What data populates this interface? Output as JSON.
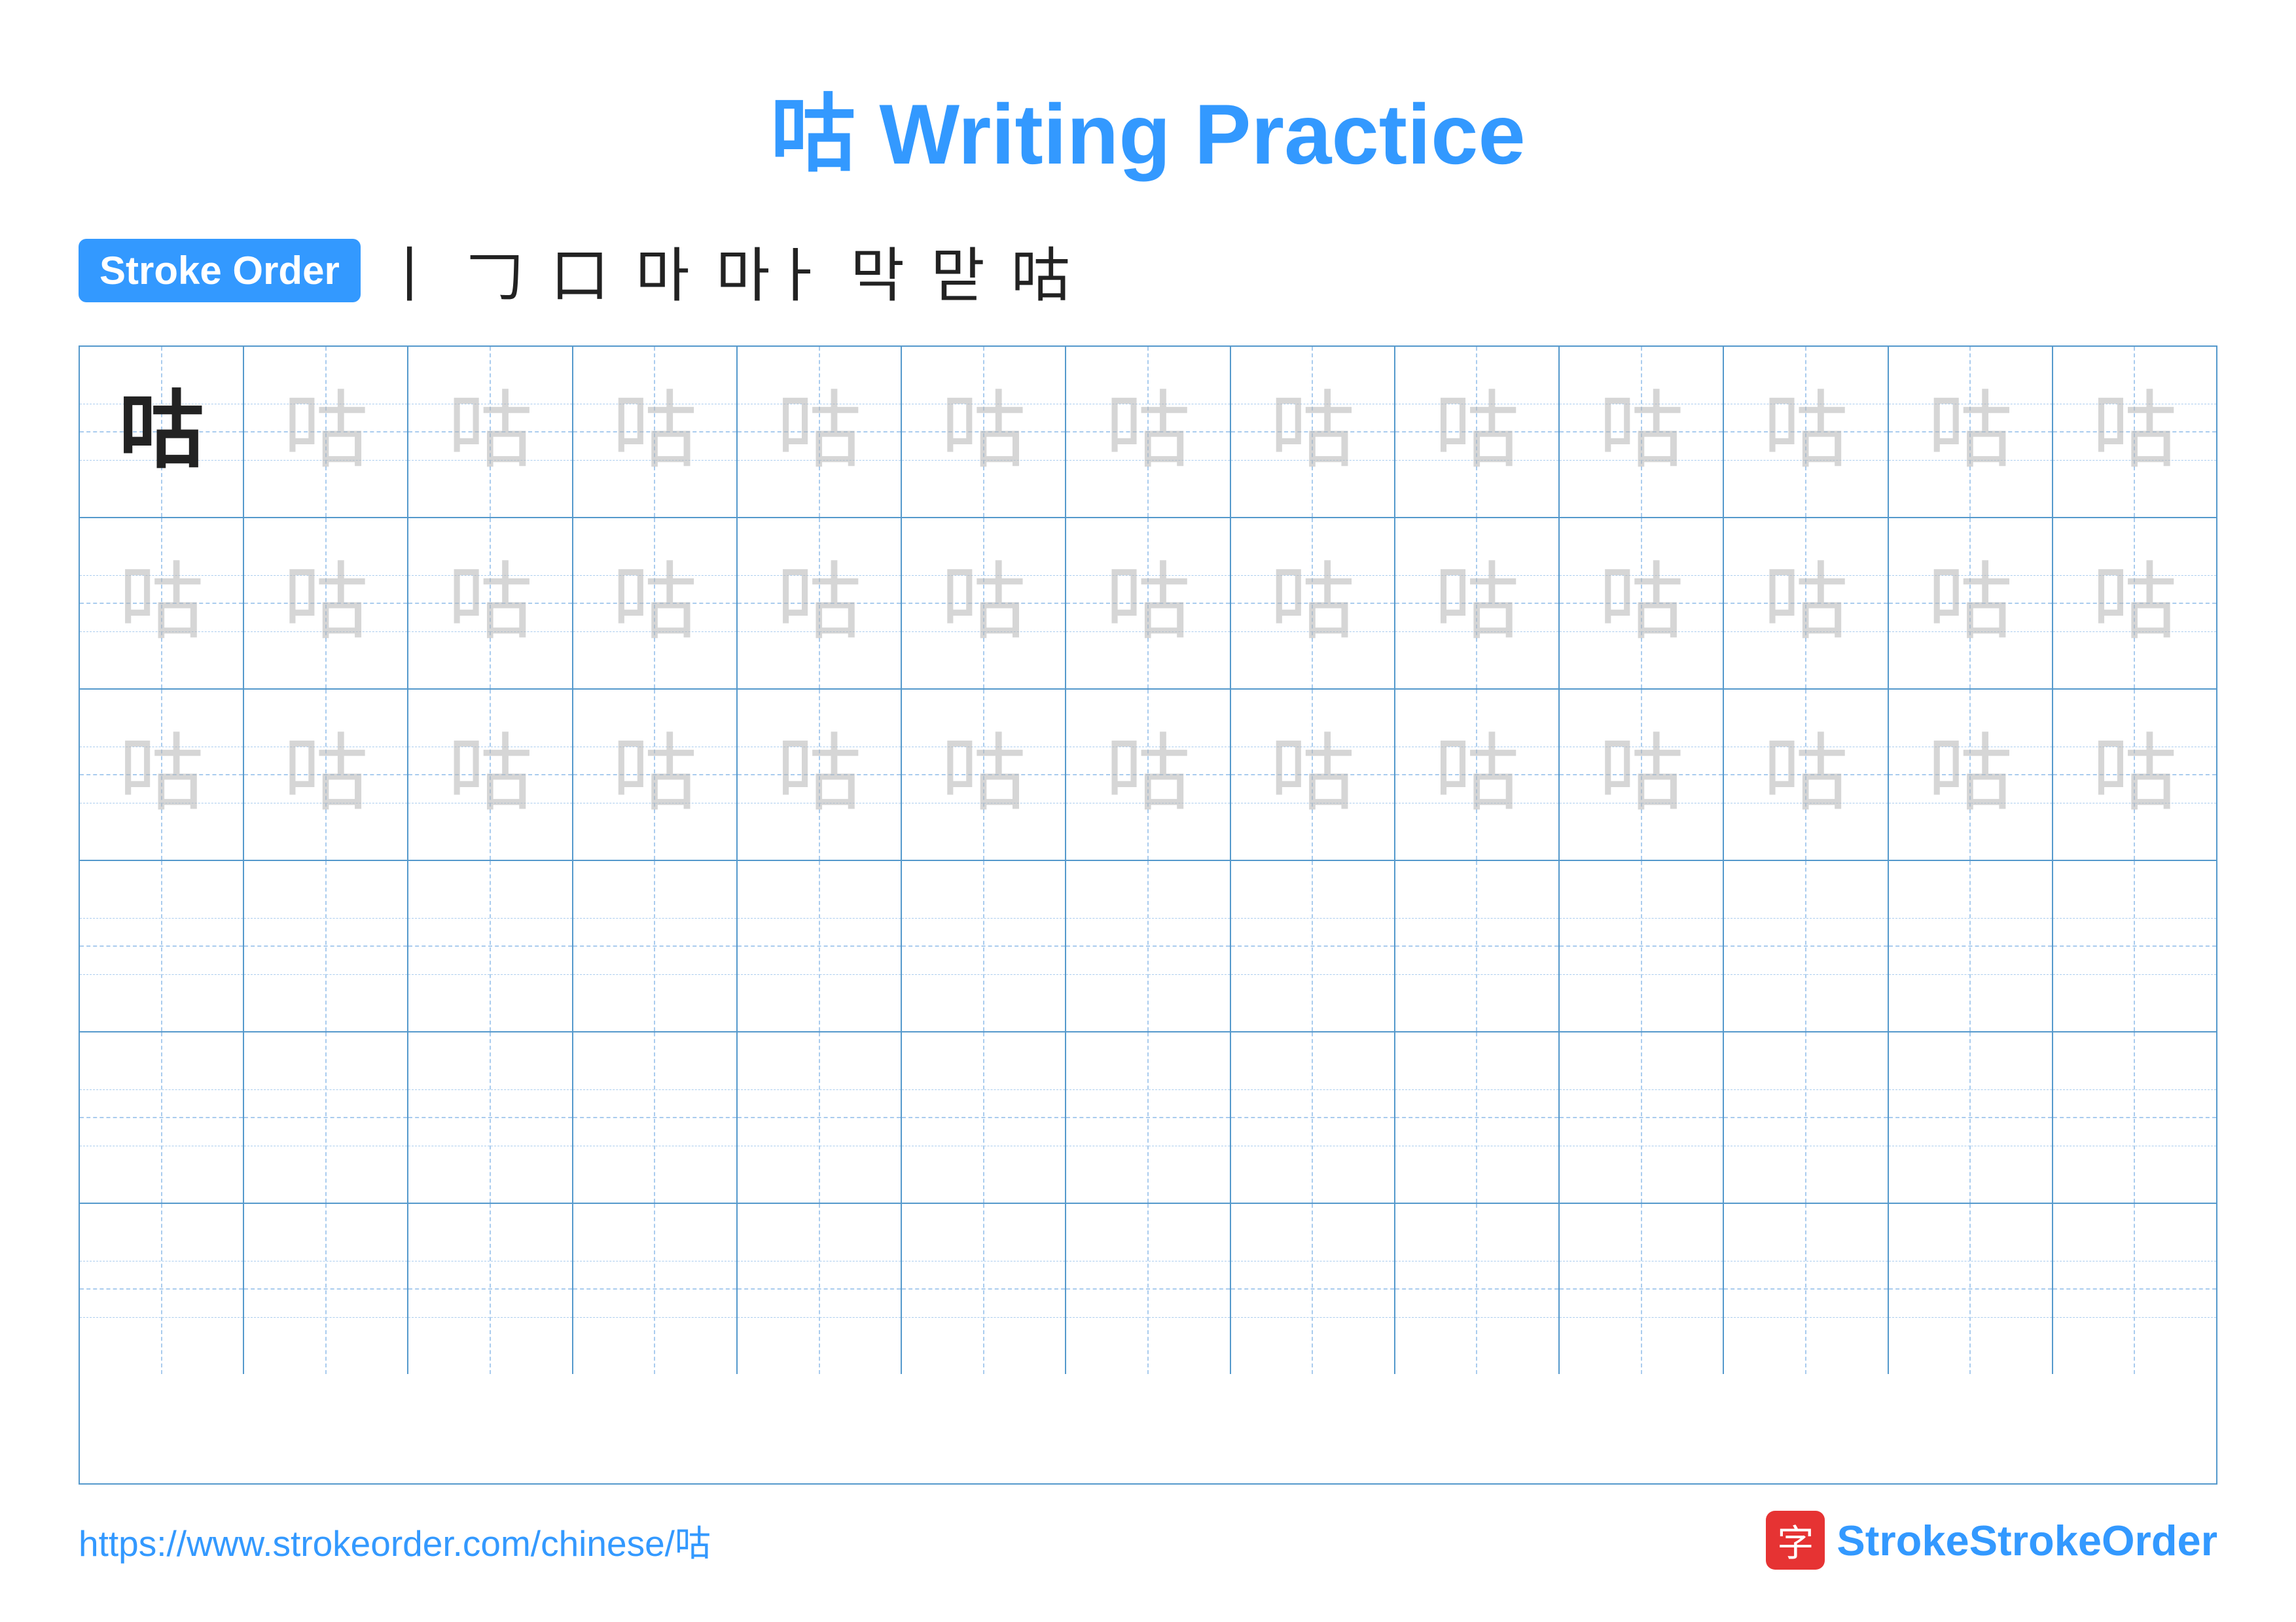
{
  "title": {
    "char": "咕",
    "label": "Writing Practice"
  },
  "stroke_order": {
    "badge": "Stroke Order",
    "steps": [
      "丨",
      "𠃌",
      "口",
      "口丨",
      "마",
      "막",
      "맏",
      "咕"
    ]
  },
  "grid": {
    "rows": 6,
    "cols": 13,
    "char": "咕",
    "example_char": "咕"
  },
  "footer": {
    "url": "https://www.strokeorder.com/chinese/咕",
    "logo_char": "字",
    "logo_name": "StrokeOrder"
  }
}
